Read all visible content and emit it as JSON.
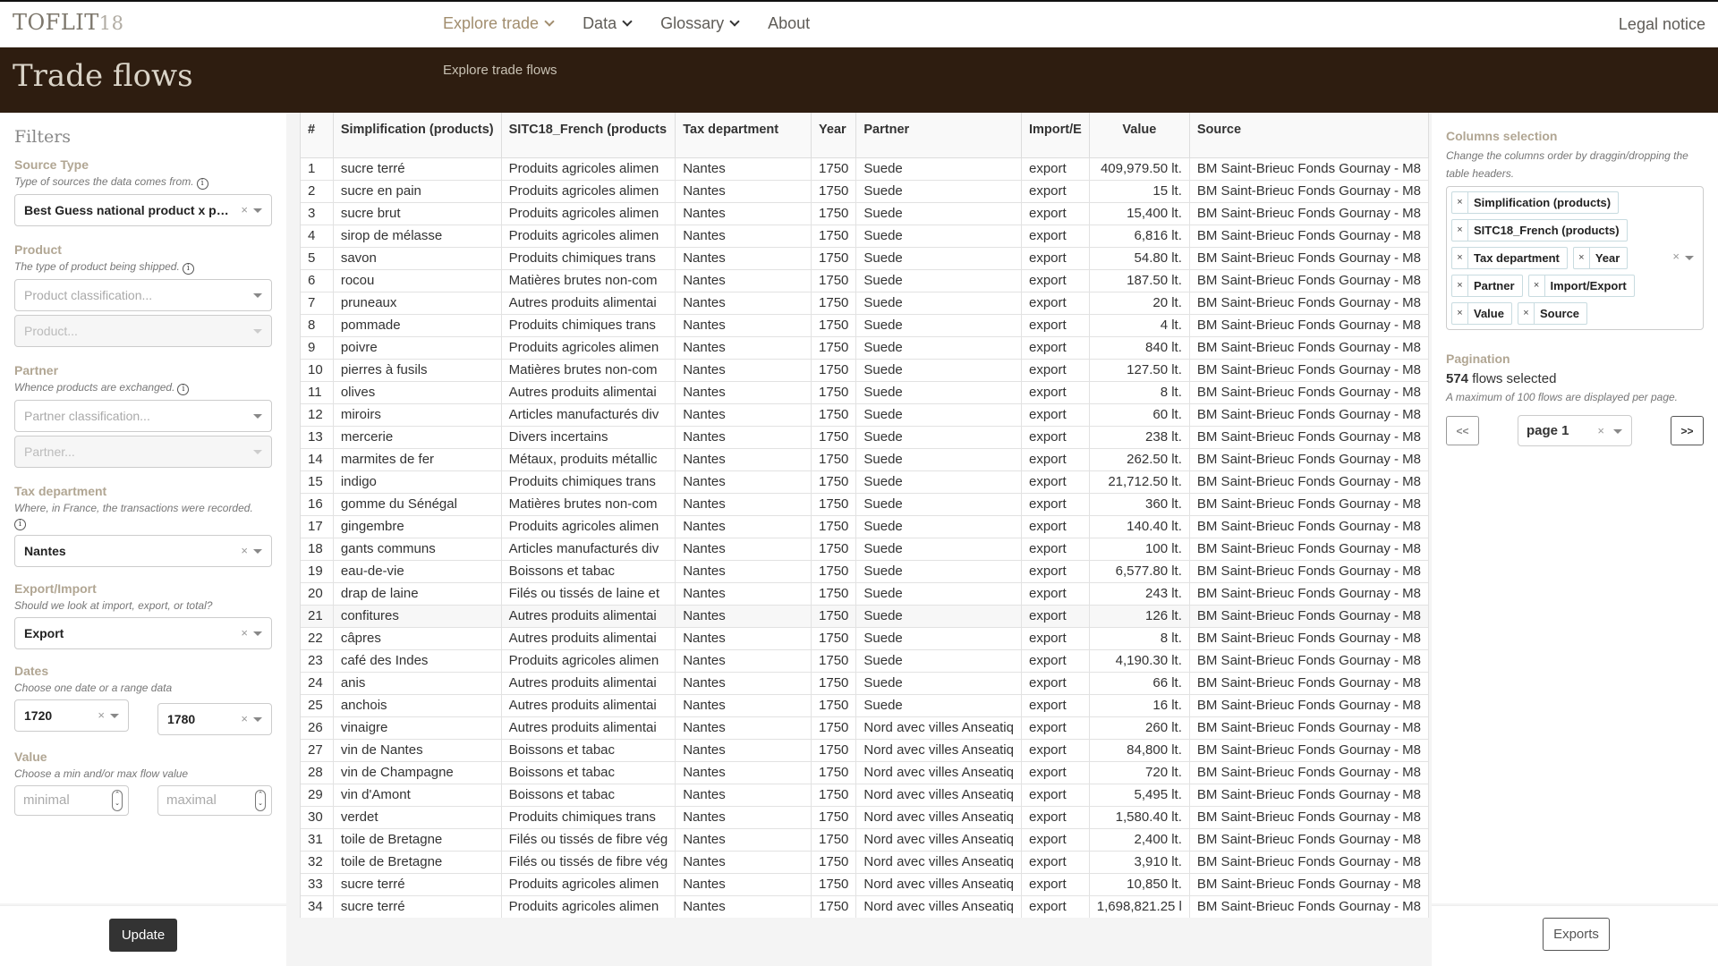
{
  "topbar": {
    "logo_text": "TOFLIT",
    "logo_num": "18",
    "nav": [
      {
        "label": "Explore trade",
        "has_dropdown": true,
        "active": true
      },
      {
        "label": "Data",
        "has_dropdown": true,
        "active": false
      },
      {
        "label": "Glossary",
        "has_dropdown": true,
        "active": false
      },
      {
        "label": "About",
        "has_dropdown": false,
        "active": false
      }
    ],
    "legal": "Legal notice"
  },
  "header": {
    "title": "Trade flows",
    "subtitle": "Explore trade flows"
  },
  "filters": {
    "title": "Filters",
    "source_type": {
      "label": "Source Type",
      "help": "Type of sources the data comes from.",
      "value": "Best Guess national product x p…"
    },
    "product": {
      "label": "Product",
      "help": "The type of product being shipped.",
      "classification_placeholder": "Product classification...",
      "item_placeholder": "Product..."
    },
    "partner": {
      "label": "Partner",
      "help": "Whence products are exchanged.",
      "classification_placeholder": "Partner classification...",
      "item_placeholder": "Partner..."
    },
    "tax_department": {
      "label": "Tax department",
      "help": "Where, in France, the transactions were recorded.",
      "value": "Nantes"
    },
    "export_import": {
      "label": "Export/Import",
      "help": "Should we look at import, export, or total?",
      "value": "Export"
    },
    "dates": {
      "label": "Dates",
      "help": "Choose one date or a range data",
      "from": "1720",
      "to": "1780"
    },
    "value": {
      "label": "Value",
      "help": "Choose a min and/or max flow value",
      "min_placeholder": "minimal",
      "max_placeholder": "maximal"
    },
    "update_label": "Update"
  },
  "table": {
    "headers": [
      "#",
      "Simplification (products)",
      "SITC18_French (products",
      "Tax department",
      "Year",
      "Partner",
      "Import/E",
      "Value",
      "Source"
    ],
    "rows": [
      [
        "1",
        "sucre terré",
        "Produits agricoles alimen",
        "Nantes",
        "1750",
        "Suede",
        "export",
        "409,979.50 lt.",
        "BM Saint-Brieuc Fonds Gournay - M8"
      ],
      [
        "2",
        "sucre en pain",
        "Produits agricoles alimen",
        "Nantes",
        "1750",
        "Suede",
        "export",
        "15 lt.",
        "BM Saint-Brieuc Fonds Gournay - M8"
      ],
      [
        "3",
        "sucre brut",
        "Produits agricoles alimen",
        "Nantes",
        "1750",
        "Suede",
        "export",
        "15,400 lt.",
        "BM Saint-Brieuc Fonds Gournay - M8"
      ],
      [
        "4",
        "sirop de mélasse",
        "Produits agricoles alimen",
        "Nantes",
        "1750",
        "Suede",
        "export",
        "6,816 lt.",
        "BM Saint-Brieuc Fonds Gournay - M8"
      ],
      [
        "5",
        "savon",
        "Produits chimiques trans",
        "Nantes",
        "1750",
        "Suede",
        "export",
        "54.80 lt.",
        "BM Saint-Brieuc Fonds Gournay - M8"
      ],
      [
        "6",
        "rocou",
        "Matières brutes non-com",
        "Nantes",
        "1750",
        "Suede",
        "export",
        "187.50 lt.",
        "BM Saint-Brieuc Fonds Gournay - M8"
      ],
      [
        "7",
        "pruneaux",
        "Autres produits alimentai",
        "Nantes",
        "1750",
        "Suede",
        "export",
        "20 lt.",
        "BM Saint-Brieuc Fonds Gournay - M8"
      ],
      [
        "8",
        "pommade",
        "Produits chimiques trans",
        "Nantes",
        "1750",
        "Suede",
        "export",
        "4 lt.",
        "BM Saint-Brieuc Fonds Gournay - M8"
      ],
      [
        "9",
        "poivre",
        "Produits agricoles alimen",
        "Nantes",
        "1750",
        "Suede",
        "export",
        "840 lt.",
        "BM Saint-Brieuc Fonds Gournay - M8"
      ],
      [
        "10",
        "pierres à fusils",
        "Matières brutes non-com",
        "Nantes",
        "1750",
        "Suede",
        "export",
        "127.50 lt.",
        "BM Saint-Brieuc Fonds Gournay - M8"
      ],
      [
        "11",
        "olives",
        "Autres produits alimentai",
        "Nantes",
        "1750",
        "Suede",
        "export",
        "8 lt.",
        "BM Saint-Brieuc Fonds Gournay - M8"
      ],
      [
        "12",
        "miroirs",
        "Articles manufacturés div",
        "Nantes",
        "1750",
        "Suede",
        "export",
        "60 lt.",
        "BM Saint-Brieuc Fonds Gournay - M8"
      ],
      [
        "13",
        "mercerie",
        "Divers incertains",
        "Nantes",
        "1750",
        "Suede",
        "export",
        "238 lt.",
        "BM Saint-Brieuc Fonds Gournay - M8"
      ],
      [
        "14",
        "marmites de fer",
        "Métaux, produits métallic",
        "Nantes",
        "1750",
        "Suede",
        "export",
        "262.50 lt.",
        "BM Saint-Brieuc Fonds Gournay - M8"
      ],
      [
        "15",
        "indigo",
        "Produits chimiques trans",
        "Nantes",
        "1750",
        "Suede",
        "export",
        "21,712.50 lt.",
        "BM Saint-Brieuc Fonds Gournay - M8"
      ],
      [
        "16",
        "gomme du Sénégal",
        "Matières brutes non-com",
        "Nantes",
        "1750",
        "Suede",
        "export",
        "360 lt.",
        "BM Saint-Brieuc Fonds Gournay - M8"
      ],
      [
        "17",
        "gingembre",
        "Produits agricoles alimen",
        "Nantes",
        "1750",
        "Suede",
        "export",
        "140.40 lt.",
        "BM Saint-Brieuc Fonds Gournay - M8"
      ],
      [
        "18",
        "gants communs",
        "Articles manufacturés div",
        "Nantes",
        "1750",
        "Suede",
        "export",
        "100 lt.",
        "BM Saint-Brieuc Fonds Gournay - M8"
      ],
      [
        "19",
        "eau-de-vie",
        "Boissons et tabac",
        "Nantes",
        "1750",
        "Suede",
        "export",
        "6,577.80 lt.",
        "BM Saint-Brieuc Fonds Gournay - M8"
      ],
      [
        "20",
        "drap de laine",
        "Filés ou tissés de laine et",
        "Nantes",
        "1750",
        "Suede",
        "export",
        "243 lt.",
        "BM Saint-Brieuc Fonds Gournay - M8"
      ],
      [
        "21",
        "confitures",
        "Autres produits alimentai",
        "Nantes",
        "1750",
        "Suede",
        "export",
        "126 lt.",
        "BM Saint-Brieuc Fonds Gournay - M8"
      ],
      [
        "22",
        "câpres",
        "Autres produits alimentai",
        "Nantes",
        "1750",
        "Suede",
        "export",
        "8 lt.",
        "BM Saint-Brieuc Fonds Gournay - M8"
      ],
      [
        "23",
        "café des Indes",
        "Produits agricoles alimen",
        "Nantes",
        "1750",
        "Suede",
        "export",
        "4,190.30 lt.",
        "BM Saint-Brieuc Fonds Gournay - M8"
      ],
      [
        "24",
        "anis",
        "Autres produits alimentai",
        "Nantes",
        "1750",
        "Suede",
        "export",
        "66 lt.",
        "BM Saint-Brieuc Fonds Gournay - M8"
      ],
      [
        "25",
        "anchois",
        "Autres produits alimentai",
        "Nantes",
        "1750",
        "Suede",
        "export",
        "16 lt.",
        "BM Saint-Brieuc Fonds Gournay - M8"
      ],
      [
        "26",
        "vinaigre",
        "Autres produits alimentai",
        "Nantes",
        "1750",
        "Nord avec villes Anseatiq",
        "export",
        "260 lt.",
        "BM Saint-Brieuc Fonds Gournay - M8"
      ],
      [
        "27",
        "vin de Nantes",
        "Boissons et tabac",
        "Nantes",
        "1750",
        "Nord avec villes Anseatiq",
        "export",
        "84,800 lt.",
        "BM Saint-Brieuc Fonds Gournay - M8"
      ],
      [
        "28",
        "vin de Champagne",
        "Boissons et tabac",
        "Nantes",
        "1750",
        "Nord avec villes Anseatiq",
        "export",
        "720 lt.",
        "BM Saint-Brieuc Fonds Gournay - M8"
      ],
      [
        "29",
        "vin d'Amont",
        "Boissons et tabac",
        "Nantes",
        "1750",
        "Nord avec villes Anseatiq",
        "export",
        "5,495 lt.",
        "BM Saint-Brieuc Fonds Gournay - M8"
      ],
      [
        "30",
        "verdet",
        "Produits chimiques trans",
        "Nantes",
        "1750",
        "Nord avec villes Anseatiq",
        "export",
        "1,580.40 lt.",
        "BM Saint-Brieuc Fonds Gournay - M8"
      ],
      [
        "31",
        "toile de Bretagne",
        "Filés ou tissés de fibre vég",
        "Nantes",
        "1750",
        "Nord avec villes Anseatiq",
        "export",
        "2,400 lt.",
        "BM Saint-Brieuc Fonds Gournay - M8"
      ],
      [
        "32",
        "toile de Bretagne",
        "Filés ou tissés de fibre vég",
        "Nantes",
        "1750",
        "Nord avec villes Anseatiq",
        "export",
        "3,910 lt.",
        "BM Saint-Brieuc Fonds Gournay - M8"
      ],
      [
        "33",
        "sucre terré",
        "Produits agricoles alimen",
        "Nantes",
        "1750",
        "Nord avec villes Anseatiq",
        "export",
        "10,850 lt.",
        "BM Saint-Brieuc Fonds Gournay - M8"
      ],
      [
        "34",
        "sucre terré",
        "Produits agricoles alimen",
        "Nantes",
        "1750",
        "Nord avec villes Anseatiq",
        "export",
        "1,698,821.25 l",
        "BM Saint-Brieuc Fonds Gournay - M8"
      ]
    ]
  },
  "columns_selection": {
    "label": "Columns selection",
    "help": "Change the columns order by draggin/dropping the table headers.",
    "chips": [
      "Simplification (products)",
      "SITC18_French (products)",
      "Tax department",
      "Year",
      "Partner",
      "Import/Export",
      "Value",
      "Source"
    ]
  },
  "pagination": {
    "label": "Pagination",
    "count": "574",
    "count_suffix": " flows selected",
    "help": "A maximum of 100 flows are displayed per page.",
    "prev_label": "<<",
    "next_label": ">>",
    "page_value": "page 1"
  },
  "exports_label": "Exports",
  "icons": {
    "clear": "×",
    "info": "i",
    "spin_up": "⌃",
    "spin_down": "⌄"
  }
}
